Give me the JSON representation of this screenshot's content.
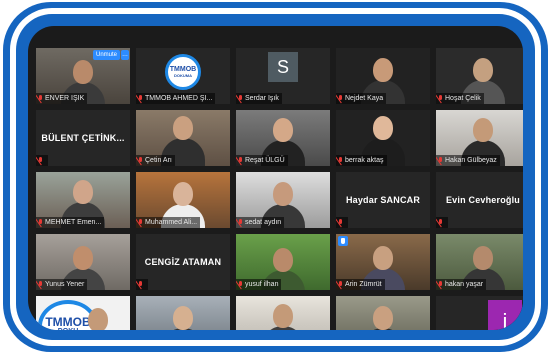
{
  "meeting": {
    "participants": [
      {
        "name": "ENVER IŞIK",
        "type": "video",
        "unmute_label": "Unmute",
        "more_label": "…"
      },
      {
        "name": "TMMOB AHMED ŞI...",
        "type": "logo",
        "logo_line1": "TMMOB",
        "logo_line2": "DOKUMA"
      },
      {
        "name": "Serdar Işık",
        "type": "avatar",
        "avatar_letter": "S"
      },
      {
        "name": "Nejdet Kaya",
        "type": "video"
      },
      {
        "name": "Hoşat Çelik",
        "type": "video"
      },
      {
        "name": "",
        "type": "text",
        "display_text": "BÜLENT ÇETİNK..."
      },
      {
        "name": "Çetin Arı",
        "type": "video"
      },
      {
        "name": "Reşat ÜLGÜ",
        "type": "video"
      },
      {
        "name": "berrak aktaş",
        "type": "video"
      },
      {
        "name": "Hakan Gülbeyaz",
        "type": "video"
      },
      {
        "name": "MEHMET Emen...",
        "type": "video"
      },
      {
        "name": "Muhammed Ali...",
        "type": "video"
      },
      {
        "name": "sedat aydın",
        "type": "video"
      },
      {
        "name": "",
        "type": "text",
        "display_text": "Haydar SANCAR"
      },
      {
        "name": "",
        "type": "text",
        "display_text": "Evin Cevheroğlu"
      },
      {
        "name": "Yunus Yener",
        "type": "video"
      },
      {
        "name": "",
        "type": "text",
        "display_text": "CENGİZ ATAMAN"
      },
      {
        "name": "yusuf ilhan",
        "type": "video"
      },
      {
        "name": "Arin Zümrüt",
        "type": "video",
        "hand_raised": true
      },
      {
        "name": "hakan yaşar",
        "type": "video"
      },
      {
        "name": "",
        "type": "logo-big",
        "logo_line1": "TMMOB",
        "logo_line2": "DOKU"
      },
      {
        "name": "",
        "type": "video"
      },
      {
        "name": "",
        "type": "video",
        "active": true
      },
      {
        "name": "",
        "type": "video"
      },
      {
        "name": "",
        "type": "avatar-i",
        "avatar_letter": "i"
      }
    ]
  },
  "colors": {
    "frame_blue": "#1565c0",
    "zoom_blue": "#2d8cff",
    "muted_red": "#e53935",
    "active_speaker": "#c6d63a",
    "avatar_purple": "#9c27b0"
  }
}
